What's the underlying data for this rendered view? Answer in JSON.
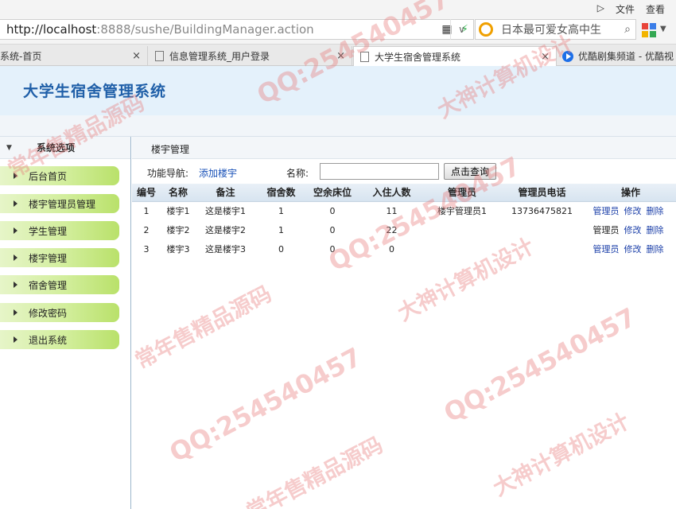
{
  "browser": {
    "top_menu": [
      "▷",
      "文件",
      "查看"
    ],
    "url_host": "http://localhost",
    "url_rest": ":8888/sushe/BuildingManager.action",
    "search_text": "日本最可爱女高中生",
    "tabs": [
      {
        "label": "系统-首页"
      },
      {
        "label": "信息管理系统_用户登录"
      },
      {
        "label": "大学生宿舍管理系统"
      },
      {
        "label": "优酷剧集频道 - 优酷视"
      }
    ],
    "tab_close": "×",
    "apps_colors": [
      "#e8443a",
      "#3a7de8",
      "#f2b400",
      "#34a853"
    ]
  },
  "header": {
    "system_title": "大学生宿舍管理系统"
  },
  "sidebar": {
    "heading": "系统选项",
    "items": [
      {
        "label": "后台首页"
      },
      {
        "label": "楼宇管理员管理"
      },
      {
        "label": "学生管理"
      },
      {
        "label": "楼宇管理"
      },
      {
        "label": "宿舍管理"
      },
      {
        "label": "修改密码"
      },
      {
        "label": "退出系统"
      }
    ]
  },
  "main": {
    "title": "楼宇管理",
    "func_nav_label": "功能导航:",
    "add_link": "添加楼宇",
    "name_label": "名称:",
    "name_value": "",
    "query_button": "点击查询",
    "columns": [
      "编号",
      "名称",
      "备注",
      "宿舍数",
      "空余床位",
      "入住人数",
      "管理员",
      "管理员电话",
      "操作"
    ],
    "rows": [
      {
        "id": "1",
        "name": "楼宇1",
        "remark": "这是楼宇1",
        "dorms": "1",
        "free_beds": "0",
        "occupants": "11",
        "admin": "楼宇管理员1",
        "phone": "13736475821",
        "op_admin": "管理员",
        "op_edit": "修改",
        "op_delete": "删除"
      },
      {
        "id": "2",
        "name": "楼宇2",
        "remark": "这是楼宇2",
        "dorms": "1",
        "free_beds": "0",
        "occupants": "22",
        "admin": "",
        "phone": "",
        "op_admin": "管理员",
        "op_edit": "修改",
        "op_delete": "删除"
      },
      {
        "id": "3",
        "name": "楼宇3",
        "remark": "这是楼宇3",
        "dorms": "0",
        "free_beds": "0",
        "occupants": "0",
        "admin": "",
        "phone": "",
        "op_admin": "管理员",
        "op_edit": "修改",
        "op_delete": "删除"
      }
    ]
  },
  "watermark": {
    "qq": "QQ:254540457",
    "tagline_1": "常年售精品源码",
    "tagline_2": "大神计算机设计"
  }
}
